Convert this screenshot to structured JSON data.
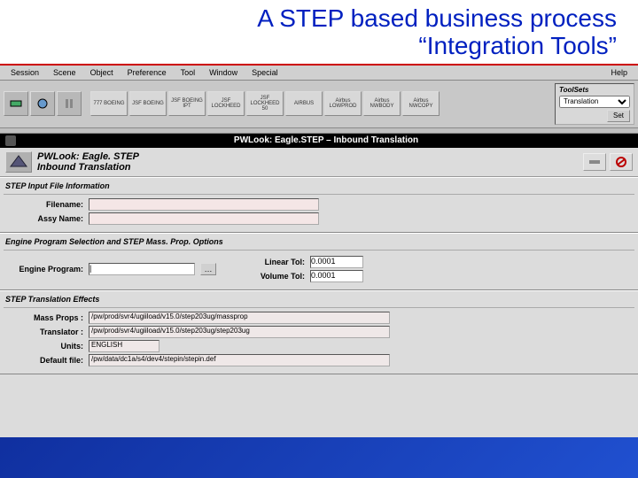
{
  "slide": {
    "title_line1": "A STEP based business process",
    "title_line2": "“Integration Tools”"
  },
  "menubar": {
    "items": [
      "Session",
      "Scene",
      "Object",
      "Preference",
      "Tool",
      "Window",
      "Special"
    ],
    "help": "Help"
  },
  "toolbar": {
    "icon_buttons": [
      "nav1",
      "nav2",
      "nav3"
    ],
    "labeled_buttons": [
      "777 BOEING",
      "JSF BOEING",
      "JSF BOEING IPT",
      "JSF LOCKHEED",
      "JSF LOCKHEED 50",
      "AIRBUS",
      "Airbus LOWPROD",
      "Airbus NWBODY",
      "Airbus NWCOPY"
    ]
  },
  "toolsets": {
    "label": "ToolSets",
    "selected": "Translation",
    "set_label": "Set"
  },
  "black_bar": {
    "text": "PWLook: Eagle.STEP – Inbound Translation"
  },
  "sub_header": {
    "line1": "PWLook: Eagle. STEP",
    "line2": "Inbound Translation"
  },
  "sections": {
    "s1": {
      "title": "STEP Input File Information",
      "filename_label": "Filename:",
      "filename_value": "",
      "assyname_label": "Assy Name:",
      "assyname_value": ""
    },
    "s2": {
      "title": "Engine Program Selection and STEP Mass. Prop. Options",
      "engine_label": "Engine Program:",
      "engine_value": "|",
      "linear_label": "Linear Tol:",
      "linear_value": "0.0001",
      "volume_label": "Volume Tol:",
      "volume_value": "0.0001"
    },
    "s3": {
      "title": "STEP Translation Effects",
      "massprops_label": "Mass Props :",
      "massprops_value": "/pw/prod/svr4/ugiiload/v15.0/step203ug/massprop",
      "translator_label": "Translator :",
      "translator_value": "/pw/prod/svr4/ugiiload/v15.0/step203ug/step203ug",
      "units_label": "Units:",
      "units_value": "ENGLISH",
      "default_label": "Default file:",
      "default_value": "/pw/data/dc1a/s4/dev4/stepin/stepin.def"
    }
  }
}
